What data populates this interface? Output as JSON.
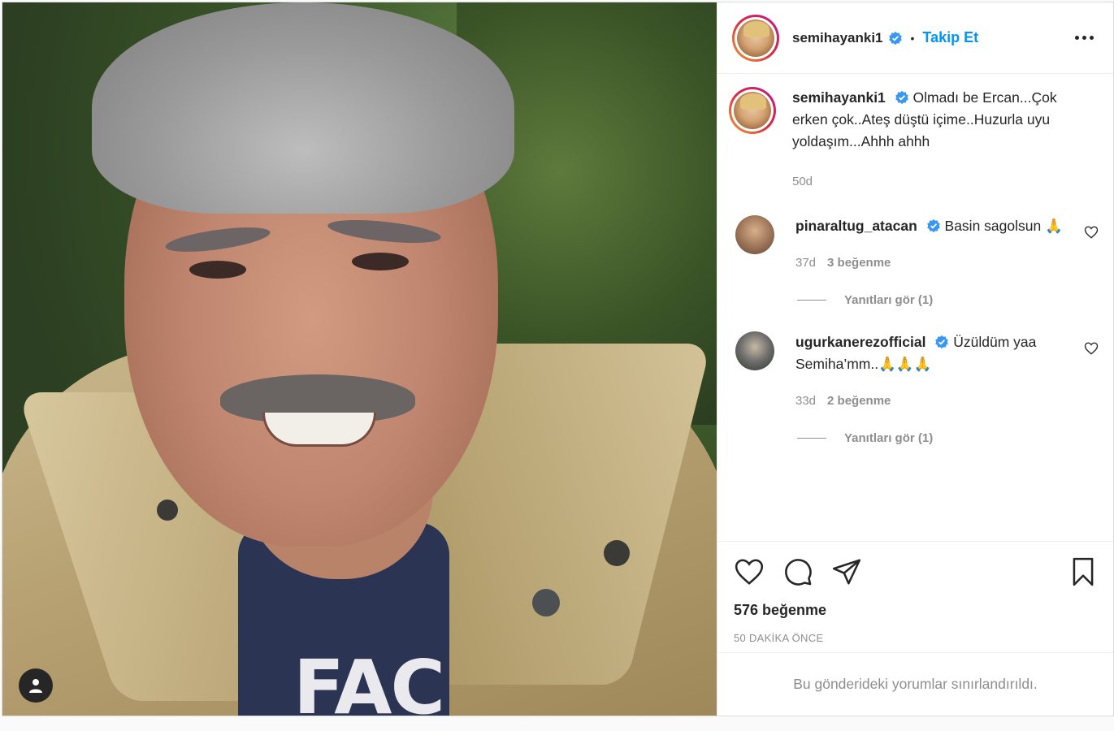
{
  "post": {
    "author": "semihayanki1",
    "follow_label": "Takip Et",
    "separator": "•",
    "photo_text": "FAC",
    "caption": {
      "username": "semihayanki1",
      "text": "Olmadı be Ercan...Çok erken çok..Ateş düştü içime..Huzurla uyu yoldaşım...Ahhh ahhh",
      "time": "50d"
    },
    "comments": [
      {
        "username": "pinaraltug_atacan",
        "text": "Basin sagolsun 🙏",
        "time": "37d",
        "likes": "3 beğenme",
        "replies": "Yanıtları gör (1)"
      },
      {
        "username": "ugurkanerezofficial",
        "text": "Üzüldüm yaa Semiha’mm..🙏🙏🙏",
        "time": "33d",
        "likes": "2 beğenme",
        "replies": "Yanıtları gör (1)"
      }
    ],
    "like_count": "576 beğenme",
    "posted": "50 DAKİKA ÖNCE",
    "comments_limited": "Bu gönderideki yorumlar sınırlandırıldı."
  },
  "colors": {
    "accent": "#0095f6",
    "verified": "#3897f0",
    "text": "#262626",
    "muted": "#8e8e8e"
  },
  "icons": [
    "user-tag-icon",
    "verified-badge-icon",
    "more-icon",
    "heart-icon",
    "comment-icon",
    "share-icon",
    "bookmark-icon"
  ]
}
